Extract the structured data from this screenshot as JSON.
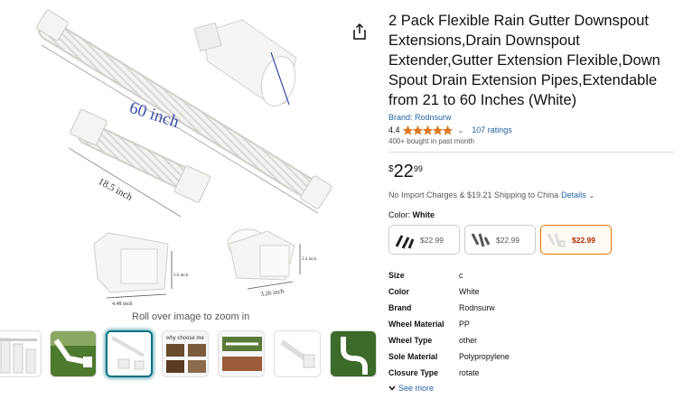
{
  "product": {
    "title": "2 Pack Flexible Rain Gutter Downspout Extensions,Drain Downspout Extender,Gutter Extension Flexible,Down Spout Drain Extension Pipes,Extendable from 21 to 60 Inches (White)",
    "brand_link": "Brand: Rodnsurw",
    "rating": "4.4",
    "rating_fraction": 0.88,
    "ratings_count": "107 ratings",
    "bought": "400+ bought in past month",
    "price_symbol": "$",
    "price_whole": "22",
    "price_fraction": "99",
    "shipping_text": "No Import Charges & $19.21 Shipping to China",
    "details_link": "Details",
    "color_label": "Color:",
    "color_value": "White",
    "see_more": "See more"
  },
  "image": {
    "zoom_hint": "Roll over image to zoom in",
    "labels": {
      "length": "60 inch",
      "short": "18.5 inch",
      "w1": "4.48 inch",
      "h1": "3.6 inch",
      "w2": "3.26 inch",
      "h2": "2.4 inch"
    }
  },
  "swatches": [
    {
      "price": "$22.99",
      "selected": false
    },
    {
      "price": "$22.99",
      "selected": false
    },
    {
      "price": "$22.99",
      "selected": true
    }
  ],
  "specs": [
    {
      "key": "Size",
      "value": "c"
    },
    {
      "key": "Color",
      "value": "White"
    },
    {
      "key": "Brand",
      "value": "Rodnsurw"
    },
    {
      "key": "Wheel Material",
      "value": "PP"
    },
    {
      "key": "Wheel Type",
      "value": "other"
    },
    {
      "key": "Sole Material",
      "value": "Polypropylene"
    },
    {
      "key": "Closure Type",
      "value": "rotate"
    }
  ],
  "thumbs_text": {
    "t4": "why choose me"
  },
  "colors": {
    "link": "#2162a1",
    "star": "#de7921",
    "selected_border": "#e77600",
    "price_red": "#b12704",
    "thumb_selected": "#007185"
  }
}
